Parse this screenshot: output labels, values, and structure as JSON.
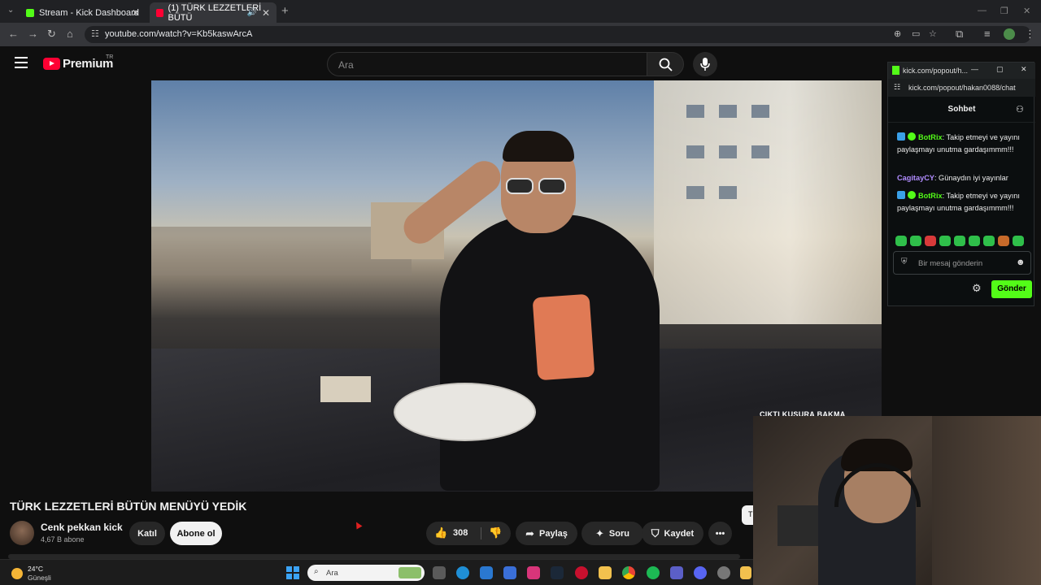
{
  "browser": {
    "tabs": [
      {
        "title": "Stream - Kick Dashboard"
      },
      {
        "title": "(1) TÜRK LEZZETLERİ BÜTÜ"
      }
    ],
    "url": "youtube.com/watch?v=Kb5kaswArcA"
  },
  "youtube": {
    "brand": "Premium",
    "region": "TR",
    "search_placeholder": "Ara",
    "video_overlay_text": "ÇIKTI KUSURA BAKMA",
    "video_title": "TÜRK LEZZETLERİ BÜTÜN MENÜYÜ YEDİK",
    "channel_name": "Cenk pekkan kick",
    "subscribers": "4,67 B abone",
    "join_label": "Katıl",
    "subscribe_label": "Abone ol",
    "like_count": "308",
    "share_label": "Paylaş",
    "ask_label": "Soru",
    "save_label": "Kaydet",
    "side_pill": "T"
  },
  "kick_chat": {
    "window_title": "kick.com/popout/h...",
    "url": "kick.com/popout/hakan0088/chat",
    "header": "Sohbet",
    "messages": [
      {
        "user": "BotRix",
        "text": ": Takip etmeyi ve yayını paylaşmayı unutma gardaşımmm!!!"
      },
      {
        "user": "CagitayCY",
        "text": ": Günaydın iyi yayınlar"
      },
      {
        "user": "BotRix",
        "text": ": Takip etmeyi ve yayını paylaşmayı unutma gardaşımmm!!!"
      }
    ],
    "input_placeholder": "Bir mesaj gönderin",
    "send_label": "Gönder",
    "accent": "#53fc18"
  },
  "taskbar": {
    "temperature": "24°C",
    "weather": "Güneşli",
    "search_placeholder": "Ara"
  }
}
